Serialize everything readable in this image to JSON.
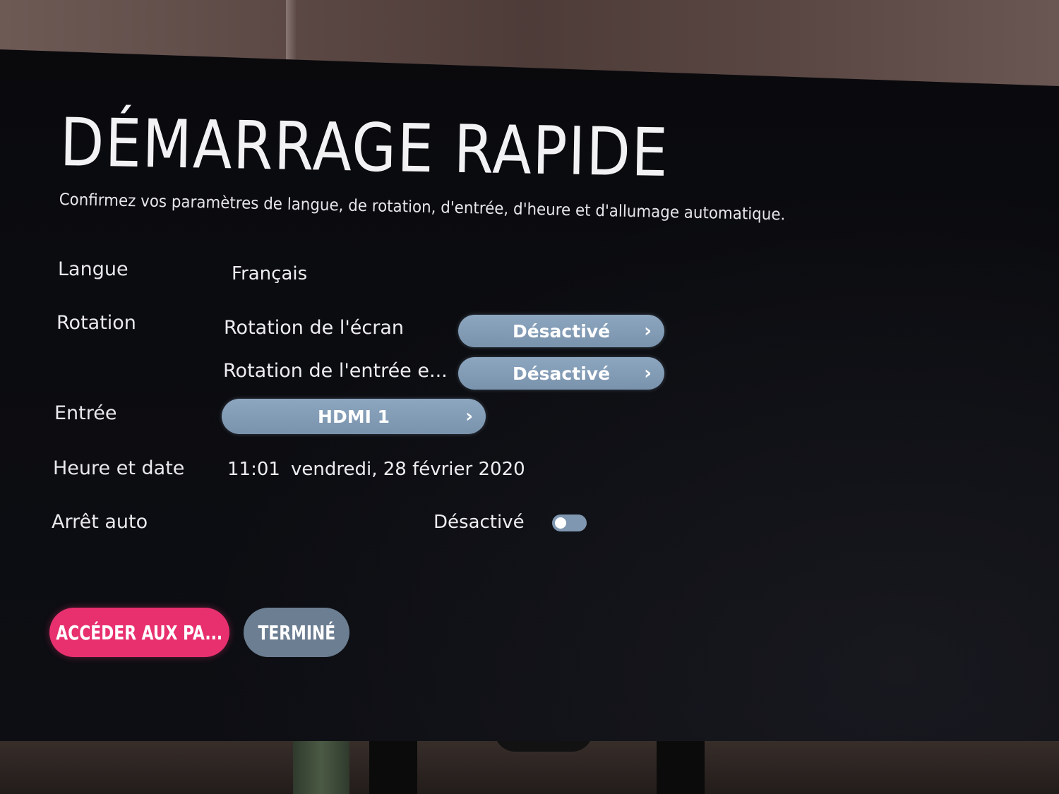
{
  "title": "DÉMARRAGE RAPIDE",
  "subtitle": "Confirmez vos paramètres de langue, de rotation, d'entrée, d'heure et d'allumage automatique.",
  "settings": {
    "language": {
      "label": "Langue",
      "value": "Français"
    },
    "rotation": {
      "label": "Rotation",
      "screen": {
        "label": "Rotation de l'écran",
        "value": "Désactivé"
      },
      "input": {
        "label": "Rotation de l'entrée e...",
        "value": "Désactivé"
      }
    },
    "input": {
      "label": "Entrée",
      "value": "HDMI 1"
    },
    "datetime": {
      "label": "Heure et date",
      "time": "11:01",
      "date": "vendredi, 28 février 2020"
    },
    "auto_off": {
      "label": "Arrêt auto",
      "status": "Désactivé",
      "enabled": false
    }
  },
  "buttons": {
    "settings": "ACCÉDER AUX PA...",
    "done": "TERMINÉ"
  },
  "icons": {
    "chevron": "›"
  },
  "colors": {
    "accent_pink": "#e8306f",
    "pill_blue": "#8da6bf",
    "done_grey": "#6c7e92",
    "background": "#0b0c10"
  }
}
